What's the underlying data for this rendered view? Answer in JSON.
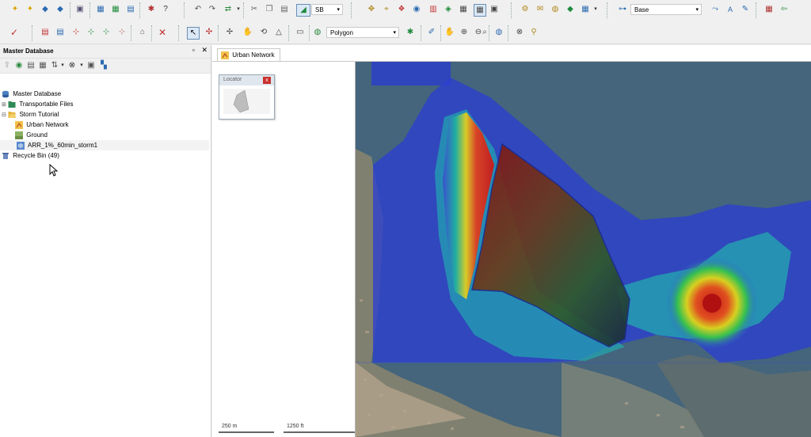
{
  "toolbar": {
    "sb_combo": "SB",
    "base_combo": "Base",
    "polygon_combo": "Polygon"
  },
  "panel": {
    "title": "Master Database",
    "tree": [
      {
        "label": "Master Database",
        "indent": 0,
        "icon": "database-icon"
      },
      {
        "label": "Transportable Files",
        "indent": 1,
        "icon": "folder-icon"
      },
      {
        "label": "Storm Tutorial",
        "indent": 1,
        "icon": "folder-open-icon"
      },
      {
        "label": "Urban Network",
        "indent": 2,
        "icon": "network-icon"
      },
      {
        "label": "Ground",
        "indent": 2,
        "icon": "ground-icon"
      },
      {
        "label": "ARR_1%_60min_storm1",
        "indent": 2,
        "icon": "rainfall-icon"
      },
      {
        "label": "Recycle Bin (49)",
        "indent": 0,
        "icon": "recycle-bin-icon"
      }
    ]
  },
  "document": {
    "tab_label": "Urban Network",
    "locator_title": "Locator",
    "scale_metric": "250 m",
    "scale_imperial": "1250 ft"
  },
  "colors": {
    "accent_red": "#c9302c",
    "water": "#4a6b82",
    "flood_blue": "#2a3fd0"
  }
}
